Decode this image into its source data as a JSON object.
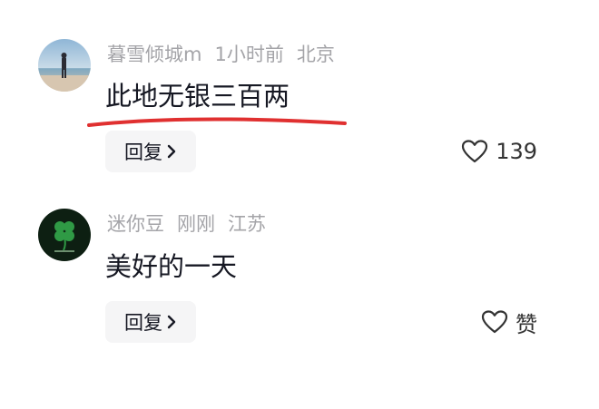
{
  "comments": [
    {
      "author": "暮雪倾城m",
      "time": "1小时前",
      "location": "北京",
      "text": "此地无银三百两",
      "reply_label": "回复",
      "like_label": "139",
      "avatar_icon": "avatar-beach-photo-icon"
    },
    {
      "author": "迷你豆",
      "time": "刚刚",
      "location": "江苏",
      "text": "美好的一天",
      "reply_label": "回复",
      "like_label": "赞",
      "avatar_icon": "avatar-clover-icon"
    }
  ],
  "colors": {
    "underline": "#e03030",
    "meta_text": "#a4a4a8",
    "body_text": "#161823",
    "reply_bg": "#f5f5f6"
  }
}
